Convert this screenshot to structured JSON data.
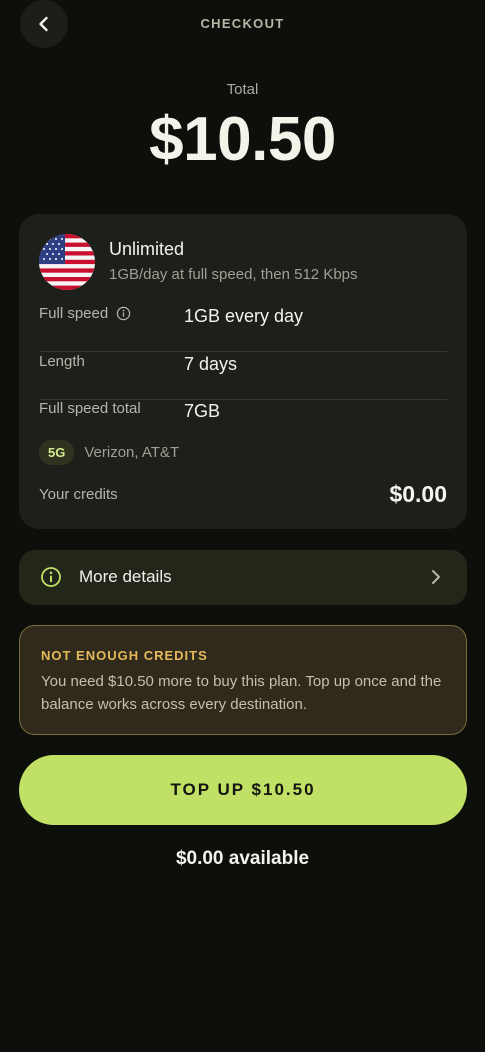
{
  "header": {
    "title": "CHECKOUT",
    "back_icon": "chevron-left-icon"
  },
  "total": {
    "label": "Total",
    "amount": "$10.50"
  },
  "plan": {
    "flag_icon": "us-flag-icon",
    "name": "Unlimited",
    "description": "1GB/day at full speed, then 512 Kbps",
    "rows": [
      {
        "label": "Full speed",
        "value": "1GB every day",
        "info_icon": "info-icon"
      },
      {
        "label": "Length",
        "value": "7 days"
      },
      {
        "label": "Full speed total",
        "value": "7GB"
      }
    ],
    "network_badge": "5G",
    "carriers": "Verizon, AT&T",
    "credits_label": "Your credits",
    "credits_value": "$0.00"
  },
  "more_details": {
    "label": "More details",
    "icon": "info-icon",
    "chevron": "chevron-right-icon"
  },
  "warning": {
    "title": "NOT ENOUGH CREDITS",
    "text": "You need $10.50 more to buy this plan. Top up once and the balance works across every destination."
  },
  "topup_button": {
    "label": "TOP UP $10.50"
  },
  "available": "$0.00 available",
  "colors": {
    "background": "#0d0f0b",
    "card": "#1d1f1a",
    "accent": "#c0e066",
    "warning": "#e5b85c"
  }
}
